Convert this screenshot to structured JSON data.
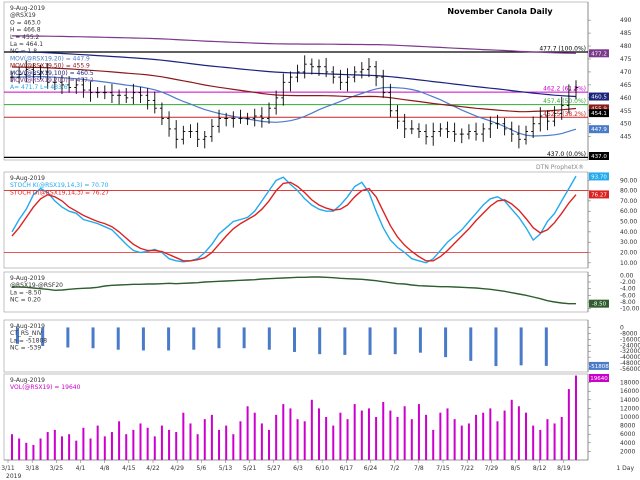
{
  "page": {
    "title": "November Canola Daily",
    "watermark": "DTN ProphetX®"
  },
  "x_axis": {
    "ticks": [
      "3/11",
      "3/18",
      "3/25",
      "4/1",
      "4/8",
      "4/15",
      "4/22",
      "4/29",
      "5/6",
      "5/13",
      "5/21",
      "5/27",
      "6/3",
      "6/10",
      "6/17",
      "6/24",
      "7/2",
      "7/8",
      "7/15",
      "7/22",
      "7/29",
      "8/5",
      "8/12",
      "8/19"
    ],
    "sep_label": "2019",
    "corner_label": "1 Day"
  },
  "chart_data": [
    {
      "panel": "price",
      "type": "candlestick",
      "legend": {
        "date": "9-Aug-2019",
        "symbol": "@RSX19",
        "open": "O = 463.0",
        "high": "H = 466.8",
        "low": "L = 455.2",
        "last": "La = 464.1",
        "net_change": "NC = 1.8"
      },
      "moving_averages": [
        {
          "label": "MOV(@RSX19,20) = 447.9",
          "color": "#4a7bc8",
          "last": 447.9
        },
        {
          "label": "MOV(@RSX19,50) = 455.9",
          "color": "#8b1a1a",
          "last": 455.9
        },
        {
          "label": "MOV(@RSX19,100) = 460.5",
          "color": "#1a237e",
          "last": 460.5
        },
        {
          "label": "MOV(@RSX19,200) = 477.2",
          "color": "#7b3a8c",
          "last": 477.2
        }
      ],
      "extra_legend": "A= 471.7 L= 433.6",
      "levels": [
        {
          "label": "477.7 (100.0%)",
          "value": 477.7,
          "color": "#000000"
        },
        {
          "label": "462.2 (61.8%)",
          "value": 462.2,
          "color": "#cc00cc"
        },
        {
          "label": "457.4 (50.0%)",
          "value": 457.4,
          "color": "#33aa33"
        },
        {
          "label": "452.5 (38.2%)",
          "value": 452.5,
          "color": "#cc2222"
        },
        {
          "label": "437.0 (0.0%)",
          "value": 437.0,
          "color": "#000000"
        }
      ],
      "y_ticks": [
        445,
        450,
        455,
        460,
        465,
        470,
        475,
        480,
        485,
        490
      ],
      "ylim": [
        436,
        497
      ],
      "right_tags": [
        {
          "text": "477.2",
          "value": 477.2,
          "color": "#7b3a8c"
        },
        {
          "text": "460.5",
          "value": 460.5,
          "color": "#1a237e"
        },
        {
          "text": "455.9",
          "value": 455.9,
          "color": "#8b1a1a"
        },
        {
          "text": "454.1",
          "value": 454.1,
          "color": "#000000"
        },
        {
          "text": "447.9",
          "value": 447.9,
          "color": "#4a7bc8"
        },
        {
          "text": "437.0",
          "value": 437.0,
          "color": "#000000"
        }
      ],
      "closes": [
        468,
        469,
        471,
        469,
        470,
        466,
        466,
        465,
        464,
        465,
        463,
        462,
        462,
        462,
        461,
        461,
        460,
        462,
        461,
        459,
        456,
        452,
        448,
        444,
        447,
        447,
        444,
        445,
        449,
        452,
        452,
        452,
        452,
        452,
        453,
        452,
        456,
        460,
        466,
        468,
        470,
        473,
        472,
        472,
        470,
        468,
        466,
        468,
        470,
        471,
        472,
        468,
        462,
        455,
        451,
        448,
        448,
        447,
        445,
        447,
        448,
        447,
        446,
        446,
        447,
        446,
        448,
        450,
        450,
        448,
        446,
        444,
        447,
        450,
        453,
        451,
        454,
        457,
        463,
        464
      ]
    },
    {
      "panel": "stochastic",
      "type": "line",
      "legend": {
        "date": "9-Aug-2019",
        "k_label": "STOCH K(@RSX19,14,3) = 70.70",
        "d_label": "STOCH D(@RSX19,14,3) = 76.27"
      },
      "series": [
        {
          "name": "STOCH K",
          "color": "#22aaee",
          "values": [
            40,
            52,
            62,
            76,
            82,
            78,
            70,
            64,
            60,
            58,
            52,
            50,
            48,
            45,
            42,
            35,
            28,
            22,
            20,
            21,
            23,
            20,
            14,
            12,
            11,
            12,
            14,
            20,
            28,
            38,
            44,
            50,
            52,
            54,
            60,
            70,
            80,
            90,
            93,
            86,
            80,
            72,
            66,
            62,
            60,
            60,
            66,
            74,
            84,
            88,
            78,
            60,
            44,
            32,
            25,
            20,
            14,
            12,
            10,
            14,
            22,
            30,
            36,
            42,
            50,
            58,
            66,
            72,
            74,
            70,
            62,
            54,
            44,
            32,
            38,
            50,
            58,
            70,
            82,
            94
          ]
        },
        {
          "name": "STOCH D",
          "color": "#dd2222",
          "values": [
            36,
            44,
            54,
            64,
            72,
            76,
            74,
            70,
            64,
            60,
            56,
            53,
            50,
            48,
            45,
            40,
            34,
            28,
            24,
            22,
            22,
            21,
            18,
            15,
            12,
            12,
            13,
            15,
            20,
            28,
            36,
            43,
            48,
            52,
            56,
            62,
            70,
            80,
            87,
            88,
            84,
            78,
            71,
            66,
            63,
            61,
            62,
            66,
            74,
            80,
            82,
            74,
            60,
            46,
            35,
            27,
            21,
            16,
            12,
            12,
            16,
            22,
            29,
            36,
            43,
            51,
            58,
            65,
            70,
            71,
            67,
            61,
            53,
            44,
            39,
            42,
            49,
            58,
            68,
            76
          ]
        }
      ],
      "levels": [
        80,
        20
      ],
      "y_ticks": [
        10,
        20,
        30,
        40,
        50,
        60,
        70,
        80,
        90
      ],
      "ylim": [
        5,
        98
      ],
      "right_tags": [
        {
          "text": "93.70",
          "value": 93.7,
          "color": "#22aaee"
        },
        {
          "text": "76.27",
          "value": 76.27,
          "color": "#dd2222"
        }
      ]
    },
    {
      "panel": "spread",
      "type": "line",
      "legend": {
        "date": "9-Aug-2019",
        "symbol": "@RSX19-@RSF20",
        "last": "La = -8.50",
        "net_change": "NC = 0.20"
      },
      "series": [
        {
          "name": "@RSX19-@RSF20",
          "color": "#2e5e2e",
          "values": [
            -3.5,
            -3.5,
            -3.6,
            -3.8,
            -4.0,
            -4.2,
            -4.5,
            -4.4,
            -4.2,
            -4.0,
            -3.9,
            -3.8,
            -3.6,
            -3.2,
            -3.0,
            -2.9,
            -2.8,
            -2.7,
            -2.7,
            -2.6,
            -2.6,
            -2.5,
            -2.4,
            -2.5,
            -2.4,
            -2.3,
            -2.2,
            -2.0,
            -1.9,
            -1.8,
            -1.7,
            -1.6,
            -1.5,
            -1.4,
            -1.3,
            -1.1,
            -1.0,
            -0.9,
            -0.8,
            -0.7,
            -0.6,
            -0.6,
            -0.5,
            -0.5,
            -0.6,
            -0.7,
            -0.9,
            -1.0,
            -1.1,
            -1.2,
            -1.4,
            -1.6,
            -1.9,
            -2.2,
            -2.5,
            -2.6,
            -2.9,
            -3.1,
            -3.2,
            -3.3,
            -3.4,
            -3.4,
            -3.5,
            -3.6,
            -3.7,
            -3.8,
            -4.0,
            -4.2,
            -4.5,
            -4.8,
            -5.2,
            -5.6,
            -6.0,
            -6.5,
            -7.0,
            -7.6,
            -8.0,
            -8.3,
            -8.5,
            -8.5
          ]
        }
      ],
      "y_ticks": [
        -10,
        -8,
        -6,
        -4,
        -2,
        0
      ],
      "ylim": [
        -11,
        1
      ],
      "right_tags": [
        {
          "text": "-8.50",
          "value": -8.5,
          "color": "#2e5e2e"
        }
      ]
    },
    {
      "panel": "cot",
      "type": "bar",
      "legend": {
        "date": "9-Aug-2019",
        "symbol": "CT_RS_NIV",
        "last": "La = -51808",
        "net_change": "NC = -539"
      },
      "series": [
        {
          "name": "CT_RS_NIV",
          "color": "#4a7bc8",
          "values": [
            -22000,
            -25000,
            -27000,
            -28000,
            -30000,
            -31000,
            -31000,
            -30000,
            -28000,
            -28000,
            -30000,
            -33000,
            -36000,
            -37000,
            -37000,
            -36000,
            -34000,
            -40000,
            -45000,
            -52000,
            -51000,
            -51800
          ]
        }
      ],
      "y_ticks": [
        8000,
        0,
        -8000,
        -16000,
        -24000,
        -32000,
        -40000,
        -48000,
        -56000
      ],
      "ylim": [
        -60000,
        10000
      ],
      "right_tags": [
        {
          "text": "-51808",
          "value": -51808,
          "color": "#4a7bc8"
        }
      ]
    },
    {
      "panel": "volume",
      "type": "bar",
      "legend": {
        "date": "9-Aug-2019",
        "symbol": "VOL(@RSX19) = 19640"
      },
      "series": [
        {
          "name": "VOL",
          "color": "#cc00cc",
          "values": [
            6000,
            5000,
            4000,
            3500,
            5000,
            6500,
            7000,
            5500,
            6000,
            4500,
            7500,
            5000,
            8000,
            5500,
            6500,
            9000,
            6000,
            7000,
            8500,
            7500,
            5500,
            8000,
            7000,
            6500,
            11000,
            8500,
            6000,
            9500,
            10500,
            7000,
            8000,
            6000,
            9000,
            12500,
            11000,
            8500,
            7000,
            10500,
            13000,
            12000,
            9500,
            9000,
            14000,
            12000,
            10000,
            8000,
            11000,
            9500,
            13000,
            11500,
            12000,
            10000,
            13500,
            11500,
            10000,
            12500,
            9500,
            13000,
            10500,
            7000,
            11000,
            12000,
            9500,
            8000,
            8500,
            10500,
            11000,
            12000,
            9000,
            11500,
            14000,
            12500,
            11000,
            8000,
            7000,
            9500,
            8500,
            10000,
            16500,
            19640
          ]
        }
      ],
      "y_ticks": [
        2000,
        4000,
        6000,
        8000,
        10000,
        12000,
        14000,
        16000,
        18000
      ],
      "ylim": [
        0,
        20000
      ],
      "right_tags": [
        {
          "text": "19640",
          "value": 19640,
          "color": "#cc00cc"
        }
      ]
    }
  ]
}
